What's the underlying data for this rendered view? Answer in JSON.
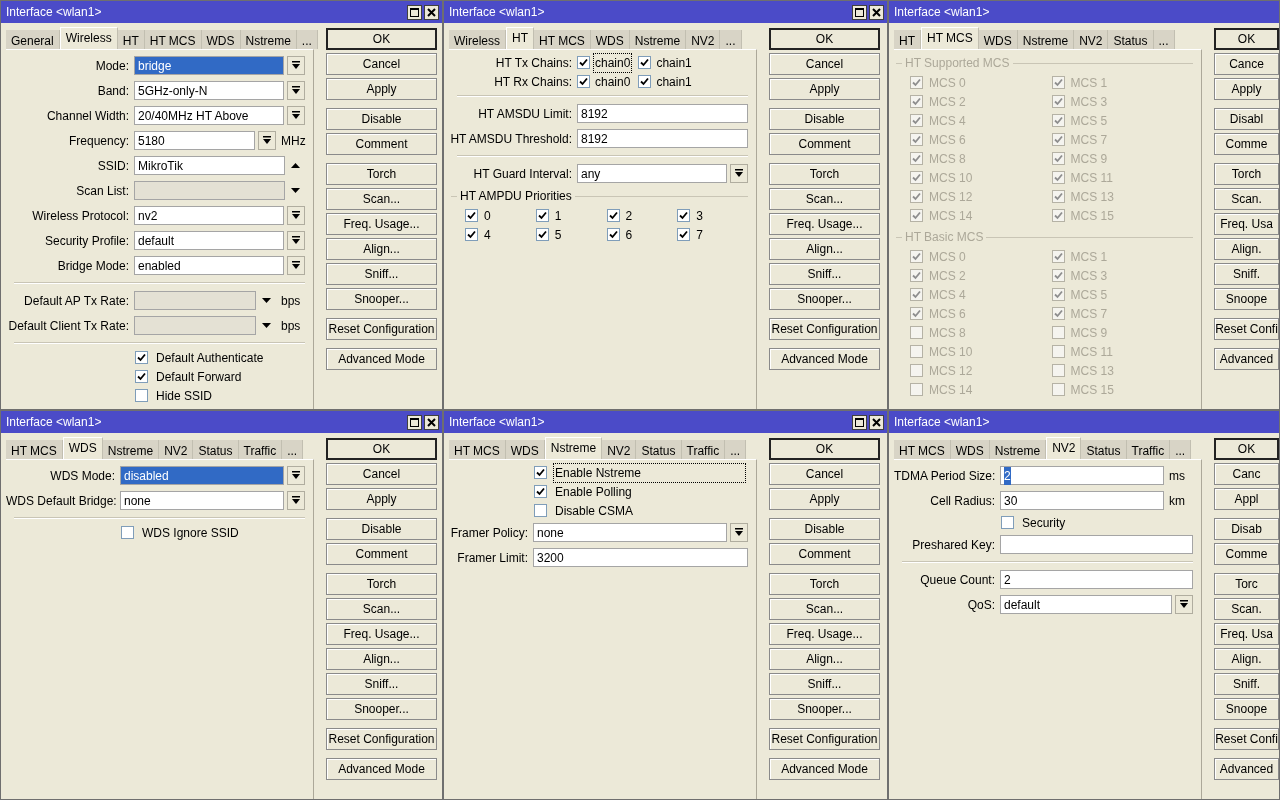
{
  "windows": [
    {
      "title": "Interface <wlan1>",
      "title_buttons": true,
      "tabs": [
        {
          "label": "General",
          "selected": false
        },
        {
          "label": "Wireless",
          "selected": true
        },
        {
          "label": "HT",
          "selected": false
        },
        {
          "label": "HT MCS",
          "selected": false
        },
        {
          "label": "WDS",
          "selected": false
        },
        {
          "label": "Nstreme",
          "selected": false
        },
        {
          "label": "...",
          "selected": false
        }
      ],
      "rows": [
        {
          "kind": "field",
          "label": "Mode:",
          "value": "bridge",
          "highlighted": true,
          "dropdown": true
        },
        {
          "kind": "field",
          "label": "Band:",
          "value": "5GHz-only-N",
          "dropdown": true
        },
        {
          "kind": "field",
          "label": "Channel Width:",
          "value": "20/40MHz HT Above",
          "dropdown": true
        },
        {
          "kind": "field",
          "label": "Frequency:",
          "value": "5180",
          "dropdown": true,
          "unit": "MHz"
        },
        {
          "kind": "field",
          "label": "SSID:",
          "value": "MikroTik",
          "arrow_up": true
        },
        {
          "kind": "field",
          "label": "Scan List:",
          "disabled": true,
          "arrow_down": true
        },
        {
          "kind": "field",
          "label": "Wireless Protocol:",
          "value": "nv2",
          "dropdown": true
        },
        {
          "kind": "field",
          "label": "Security Profile:",
          "value": "default",
          "dropdown": true
        },
        {
          "kind": "field",
          "label": "Bridge Mode:",
          "value": "enabled",
          "dropdown": true
        },
        {
          "kind": "separator"
        },
        {
          "kind": "field",
          "label": "Default AP Tx Rate:",
          "disabled": true,
          "arrow_down": true,
          "unit": "bps"
        },
        {
          "kind": "field",
          "label": "Default Client Tx Rate:",
          "disabled": true,
          "arrow_down": true,
          "unit": "bps"
        },
        {
          "kind": "separator"
        },
        {
          "kind": "check",
          "label": "Default Authenticate",
          "checked": true
        },
        {
          "kind": "check",
          "label": "Default Forward",
          "checked": true
        },
        {
          "kind": "check",
          "label": "Hide SSID",
          "checked": false
        }
      ],
      "button_groups": [
        [
          {
            "label": "OK",
            "default": true
          },
          {
            "label": "Cancel",
            "default": false
          },
          {
            "label": "Apply",
            "default": false
          }
        ],
        [
          {
            "label": "Disable",
            "default": false
          },
          {
            "label": "Comment",
            "default": false
          }
        ],
        [
          {
            "label": "Torch",
            "default": false
          },
          {
            "label": "Scan...",
            "default": false
          },
          {
            "label": "Freq. Usage...",
            "default": false
          },
          {
            "label": "Align...",
            "default": false
          },
          {
            "label": "Sniff...",
            "default": false
          },
          {
            "label": "Snooper...",
            "default": false
          }
        ],
        [
          {
            "label": "Reset Configuration",
            "default": false
          }
        ],
        [
          {
            "label": "Advanced Mode",
            "default": false
          }
        ]
      ]
    },
    {
      "title": "Interface <wlan1>",
      "title_buttons": true,
      "tabs": [
        {
          "label": "Wireless",
          "selected": false
        },
        {
          "label": "HT",
          "selected": true
        },
        {
          "label": "HT MCS",
          "selected": false
        },
        {
          "label": "WDS",
          "selected": false
        },
        {
          "label": "Nstreme",
          "selected": false
        },
        {
          "label": "NV2",
          "selected": false
        },
        {
          "label": "...",
          "selected": false
        }
      ],
      "rows": [
        {
          "kind": "check_pair",
          "label": "HT Tx Chains:",
          "items": [
            {
              "label": "chain0",
              "checked": true,
              "focused": true
            },
            {
              "label": "chain1",
              "checked": true,
              "focused": false
            }
          ]
        },
        {
          "kind": "check_pair",
          "label": "HT Rx Chains:",
          "items": [
            {
              "label": "chain0",
              "checked": true,
              "focused": false
            },
            {
              "label": "chain1",
              "checked": true,
              "focused": false
            }
          ]
        },
        {
          "kind": "separator"
        },
        {
          "kind": "field",
          "label": "HT AMSDU Limit:",
          "value": "8192"
        },
        {
          "kind": "field",
          "label": "HT AMSDU Threshold:",
          "value": "8192"
        },
        {
          "kind": "separator"
        },
        {
          "kind": "field",
          "label": "HT Guard Interval:",
          "value": "any",
          "dropdown": true
        },
        {
          "kind": "group",
          "title": "HT AMPDU Priorities",
          "disabled": false,
          "items": [
            {
              "label": "0",
              "checked": true
            },
            {
              "label": "1",
              "checked": true
            },
            {
              "label": "2",
              "checked": true
            },
            {
              "label": "3",
              "checked": true
            },
            {
              "label": "4",
              "checked": true
            },
            {
              "label": "5",
              "checked": true
            },
            {
              "label": "6",
              "checked": true
            },
            {
              "label": "7",
              "checked": true
            }
          ]
        }
      ],
      "button_groups": [
        [
          {
            "label": "OK",
            "default": true
          },
          {
            "label": "Cancel",
            "default": false
          },
          {
            "label": "Apply",
            "default": false
          }
        ],
        [
          {
            "label": "Disable",
            "default": false
          },
          {
            "label": "Comment",
            "default": false
          }
        ],
        [
          {
            "label": "Torch",
            "default": false
          },
          {
            "label": "Scan...",
            "default": false
          },
          {
            "label": "Freq. Usage...",
            "default": false
          },
          {
            "label": "Align...",
            "default": false
          },
          {
            "label": "Sniff...",
            "default": false
          },
          {
            "label": "Snooper...",
            "default": false
          }
        ],
        [
          {
            "label": "Reset Configuration",
            "default": false
          }
        ],
        [
          {
            "label": "Advanced Mode",
            "default": false
          }
        ]
      ]
    },
    {
      "title": "Interface <wlan1>",
      "title_buttons": false,
      "tabs": [
        {
          "label": "HT",
          "selected": false
        },
        {
          "label": "HT MCS",
          "selected": true
        },
        {
          "label": "WDS",
          "selected": false
        },
        {
          "label": "Nstreme",
          "selected": false
        },
        {
          "label": "NV2",
          "selected": false
        },
        {
          "label": "Status",
          "selected": false
        },
        {
          "label": "...",
          "selected": false
        }
      ],
      "rows": [
        {
          "kind": "group",
          "title": "HT Supported MCS",
          "disabled": true,
          "items": [
            {
              "label": "MCS 0",
              "checked": true
            },
            {
              "label": "MCS 1",
              "checked": true
            },
            {
              "label": "MCS 2",
              "checked": true
            },
            {
              "label": "MCS 3",
              "checked": true
            },
            {
              "label": "MCS 4",
              "checked": true
            },
            {
              "label": "MCS 5",
              "checked": true
            },
            {
              "label": "MCS 6",
              "checked": true
            },
            {
              "label": "MCS 7",
              "checked": true
            },
            {
              "label": "MCS 8",
              "checked": true
            },
            {
              "label": "MCS 9",
              "checked": true
            },
            {
              "label": "MCS 10",
              "checked": true
            },
            {
              "label": "MCS 11",
              "checked": true
            },
            {
              "label": "MCS 12",
              "checked": true
            },
            {
              "label": "MCS 13",
              "checked": true
            },
            {
              "label": "MCS 14",
              "checked": true
            },
            {
              "label": "MCS 15",
              "checked": true
            }
          ]
        },
        {
          "kind": "group",
          "title": "HT Basic MCS",
          "disabled": true,
          "items": [
            {
              "label": "MCS 0",
              "checked": true
            },
            {
              "label": "MCS 1",
              "checked": true
            },
            {
              "label": "MCS 2",
              "checked": true
            },
            {
              "label": "MCS 3",
              "checked": true
            },
            {
              "label": "MCS 4",
              "checked": true
            },
            {
              "label": "MCS 5",
              "checked": true
            },
            {
              "label": "MCS 6",
              "checked": true
            },
            {
              "label": "MCS 7",
              "checked": true
            },
            {
              "label": "MCS 8",
              "checked": false
            },
            {
              "label": "MCS 9",
              "checked": false
            },
            {
              "label": "MCS 10",
              "checked": false
            },
            {
              "label": "MCS 11",
              "checked": false
            },
            {
              "label": "MCS 12",
              "checked": false
            },
            {
              "label": "MCS 13",
              "checked": false
            },
            {
              "label": "MCS 14",
              "checked": false
            },
            {
              "label": "MCS 15",
              "checked": false
            }
          ]
        }
      ],
      "button_groups": [
        [
          {
            "label": "OK",
            "default": true
          },
          {
            "label": "Cance",
            "default": false
          },
          {
            "label": "Apply",
            "default": false
          }
        ],
        [
          {
            "label": "Disabl",
            "default": false
          },
          {
            "label": "Comme",
            "default": false
          }
        ],
        [
          {
            "label": "Torch",
            "default": false
          },
          {
            "label": "Scan.",
            "default": false
          },
          {
            "label": "Freq. Usa",
            "default": false
          },
          {
            "label": "Align.",
            "default": false
          },
          {
            "label": "Sniff.",
            "default": false
          },
          {
            "label": "Snoope",
            "default": false
          }
        ],
        [
          {
            "label": "Reset Confi",
            "default": false
          }
        ],
        [
          {
            "label": "Advanced",
            "default": false
          }
        ]
      ]
    },
    {
      "title": "Interface <wlan1>",
      "title_buttons": true,
      "tabs": [
        {
          "label": "HT MCS",
          "selected": false
        },
        {
          "label": "WDS",
          "selected": true
        },
        {
          "label": "Nstreme",
          "selected": false
        },
        {
          "label": "NV2",
          "selected": false
        },
        {
          "label": "Status",
          "selected": false
        },
        {
          "label": "Traffic",
          "selected": false
        },
        {
          "label": "...",
          "selected": false
        }
      ],
      "rows": [
        {
          "kind": "field",
          "label": "WDS Mode:",
          "value": "disabled",
          "highlighted": true,
          "dropdown": true
        },
        {
          "kind": "field",
          "label": "WDS Default Bridge:",
          "value": "none",
          "dropdown": true
        },
        {
          "kind": "separator"
        },
        {
          "kind": "check",
          "label": "WDS Ignore SSID",
          "checked": false
        }
      ],
      "button_groups": [
        [
          {
            "label": "OK",
            "default": true
          },
          {
            "label": "Cancel",
            "default": false
          },
          {
            "label": "Apply",
            "default": false
          }
        ],
        [
          {
            "label": "Disable",
            "default": false
          },
          {
            "label": "Comment",
            "default": false
          }
        ],
        [
          {
            "label": "Torch",
            "default": false
          },
          {
            "label": "Scan...",
            "default": false
          },
          {
            "label": "Freq. Usage...",
            "default": false
          },
          {
            "label": "Align...",
            "default": false
          },
          {
            "label": "Sniff...",
            "default": false
          },
          {
            "label": "Snooper...",
            "default": false
          }
        ],
        [
          {
            "label": "Reset Configuration",
            "default": false
          }
        ],
        [
          {
            "label": "Advanced Mode",
            "default": false
          }
        ]
      ]
    },
    {
      "title": "Interface <wlan1>",
      "title_buttons": true,
      "tabs": [
        {
          "label": "HT MCS",
          "selected": false
        },
        {
          "label": "WDS",
          "selected": false
        },
        {
          "label": "Nstreme",
          "selected": true
        },
        {
          "label": "NV2",
          "selected": false
        },
        {
          "label": "Status",
          "selected": false
        },
        {
          "label": "Traffic",
          "selected": false
        },
        {
          "label": "...",
          "selected": false
        }
      ],
      "rows": [
        {
          "kind": "check",
          "label": "Enable Nstreme",
          "checked": true,
          "focused": true
        },
        {
          "kind": "check",
          "label": "Enable Polling",
          "checked": true
        },
        {
          "kind": "check",
          "label": "Disable CSMA",
          "checked": false
        },
        {
          "kind": "field",
          "label": "Framer Policy:",
          "value": "none",
          "dropdown": true
        },
        {
          "kind": "field",
          "label": "Framer Limit:",
          "value": "3200"
        }
      ],
      "button_groups": [
        [
          {
            "label": "OK",
            "default": true
          },
          {
            "label": "Cancel",
            "default": false
          },
          {
            "label": "Apply",
            "default": false
          }
        ],
        [
          {
            "label": "Disable",
            "default": false
          },
          {
            "label": "Comment",
            "default": false
          }
        ],
        [
          {
            "label": "Torch",
            "default": false
          },
          {
            "label": "Scan...",
            "default": false
          },
          {
            "label": "Freq. Usage...",
            "default": false
          },
          {
            "label": "Align...",
            "default": false
          },
          {
            "label": "Sniff...",
            "default": false
          },
          {
            "label": "Snooper...",
            "default": false
          }
        ],
        [
          {
            "label": "Reset Configuration",
            "default": false
          }
        ],
        [
          {
            "label": "Advanced Mode",
            "default": false
          }
        ]
      ]
    },
    {
      "title": "Interface <wlan1>",
      "title_buttons": false,
      "tabs": [
        {
          "label": "HT MCS",
          "selected": false
        },
        {
          "label": "WDS",
          "selected": false
        },
        {
          "label": "Nstreme",
          "selected": false
        },
        {
          "label": "NV2",
          "selected": true
        },
        {
          "label": "Status",
          "selected": false
        },
        {
          "label": "Traffic",
          "selected": false
        },
        {
          "label": "...",
          "selected": false
        }
      ],
      "rows": [
        {
          "kind": "field",
          "label": "TDMA Period Size:",
          "value": "2",
          "highlighted": true,
          "unit": "ms"
        },
        {
          "kind": "field",
          "label": "Cell Radius:",
          "value": "30",
          "unit": "km"
        },
        {
          "kind": "check",
          "label": "Security",
          "checked": false
        },
        {
          "kind": "field",
          "label": "Preshared Key:"
        },
        {
          "kind": "separator"
        },
        {
          "kind": "field",
          "label": "Queue Count:",
          "value": "2"
        },
        {
          "kind": "field",
          "label": "QoS:",
          "value": "default",
          "dropdown": true
        }
      ],
      "button_groups": [
        [
          {
            "label": "OK",
            "default": true
          },
          {
            "label": "Canc",
            "default": false
          },
          {
            "label": "Appl",
            "default": false
          }
        ],
        [
          {
            "label": "Disab",
            "default": false
          },
          {
            "label": "Comme",
            "default": false
          }
        ],
        [
          {
            "label": "Torc",
            "default": false
          },
          {
            "label": "Scan.",
            "default": false
          },
          {
            "label": "Freq. Usa",
            "default": false
          },
          {
            "label": "Align.",
            "default": false
          },
          {
            "label": "Sniff.",
            "default": false
          },
          {
            "label": "Snoope",
            "default": false
          }
        ],
        [
          {
            "label": "Reset Confi",
            "default": false
          }
        ],
        [
          {
            "label": "Advanced",
            "default": false
          }
        ]
      ]
    }
  ]
}
